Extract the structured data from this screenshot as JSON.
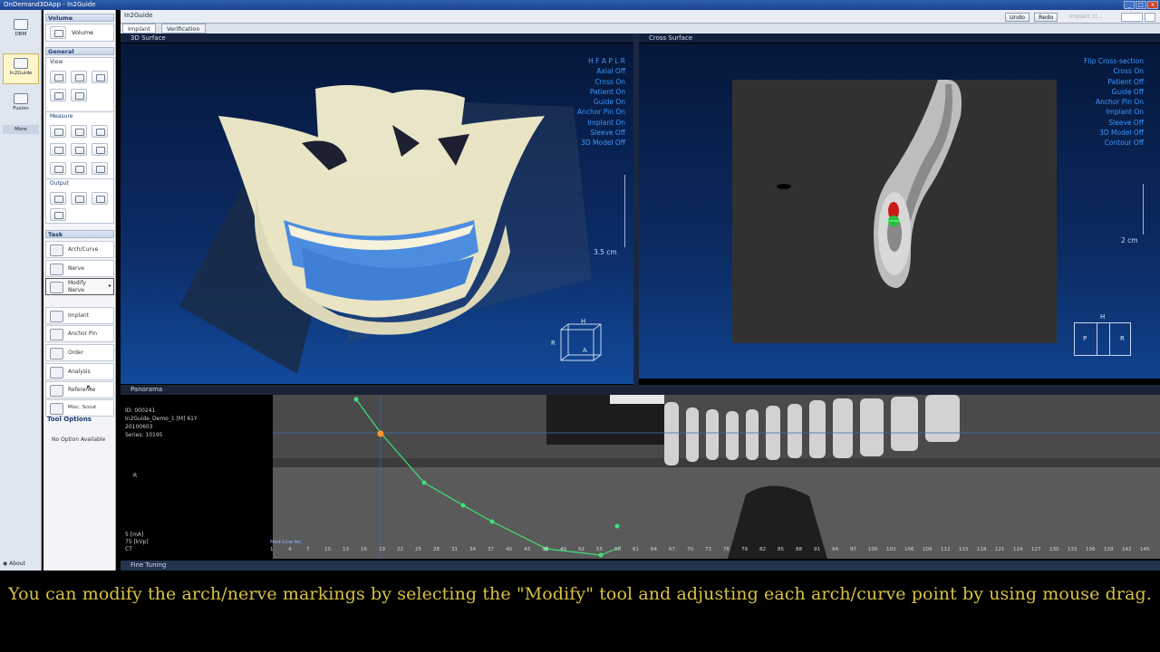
{
  "window": {
    "title": "OnDemand3DApp - In2Guide"
  },
  "modes": [
    {
      "label": "DBM",
      "icon": "database-icon"
    },
    {
      "label": "In2Guide",
      "icon": "implant-guide-icon"
    },
    {
      "label": "Fusion",
      "icon": "fusion-icon"
    }
  ],
  "modestrip": {
    "more": "More",
    "about": "About"
  },
  "panel": {
    "volume_header": "Volume",
    "volume_button": "Volume",
    "general_header": "General",
    "view_label": "View",
    "measure_label": "Measure",
    "output_label": "Output",
    "task_header": "Task",
    "tasks": [
      "Arch/Curve",
      "Nerve",
      "Modify",
      "Implant",
      "Anchor Pin",
      "Order",
      "Analysis",
      "Reference",
      "Misc. Scout"
    ],
    "modify_sub": "Nerve",
    "tool_options_header": "Tool Options",
    "no_option": "No Option Available"
  },
  "workspace": {
    "title": "In2Guide",
    "undo": "Undo",
    "redo": "Redo",
    "implant_selector": "Implant 1(...",
    "tabs": [
      "Implant",
      "Verification"
    ]
  },
  "view3d": {
    "title": "3D Surface",
    "overlay": [
      "H F A P L R",
      "Axial Off",
      "Cross On",
      "Patient On",
      "Guide On",
      "Anchor Pin On",
      "Implant On",
      "Sleeve Off",
      "3D Model Off"
    ],
    "scale": "3.5 cm",
    "cube_labels": {
      "top": "H",
      "left": "R",
      "front": "A"
    }
  },
  "cross": {
    "title": "Cross Surface",
    "overlay": [
      "Flip Cross-section",
      "Cross On",
      "Patient Off",
      "Guide Off",
      "Anchor Pin On",
      "Implant On",
      "Sleeve Off",
      "3D Model Off",
      "Contour Off"
    ],
    "scale": "2 cm",
    "orient": {
      "top": "H",
      "left": "P",
      "right": "R"
    }
  },
  "panorama": {
    "title": "Panorama",
    "info": [
      "ID: 000241",
      "In2Guide_Demo_1 [M] 61Y",
      "20100603",
      "Series: 10195"
    ],
    "tech": [
      "5 [mA]",
      "75 [kVp]",
      "CT"
    ],
    "marker_label": "Med-Line No.",
    "ticks": [
      "1",
      "4",
      "7",
      "10",
      "13",
      "16",
      "19",
      "22",
      "25",
      "28",
      "31",
      "34",
      "37",
      "40",
      "43",
      "46",
      "49",
      "52",
      "55",
      "58",
      "61",
      "64",
      "67",
      "70",
      "73",
      "76",
      "79",
      "82",
      "85",
      "88",
      "91",
      "94",
      "97",
      "100",
      "103",
      "106",
      "109",
      "112",
      "115",
      "118",
      "121",
      "124",
      "127",
      "130",
      "133",
      "136",
      "139",
      "142",
      "145"
    ],
    "side_label": "R"
  },
  "finetuning": {
    "title": "Fine Tuning"
  },
  "caption": {
    "text": "You can modify the arch/nerve markings by selecting the \"Modify\" tool and adjusting each arch/curve point by using mouse drag."
  },
  "colors": {
    "overlay_text": "#3b97ff",
    "caption_text": "#d8c146",
    "nerve_curve": "#3fe07a",
    "selected_point": "#ff9a2a"
  }
}
